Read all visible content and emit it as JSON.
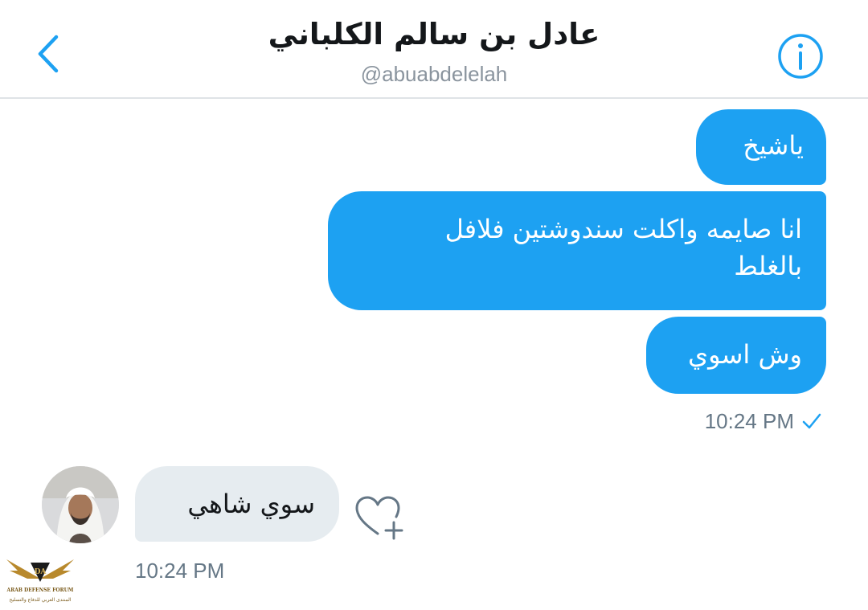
{
  "header": {
    "title": "عادل بن سالم الكلباني",
    "handle": "@abuabdelelah"
  },
  "icons": {
    "back": "chevron-left-icon",
    "info": "info-circle-icon",
    "check": "checkmark-icon",
    "heart_add": "heart-plus-icon"
  },
  "colors": {
    "accent": "#1da1f2",
    "sent_bubble": "#1da1f2",
    "received_bubble": "#e6ecf0",
    "muted_text": "#657786"
  },
  "conversation": {
    "sent_messages": [
      {
        "line1": "ياشيخ"
      },
      {
        "line1": "انا صايمه واكلت سندوشتين فلافل",
        "line2": "بالغلط"
      },
      {
        "line1": "وش اسوي"
      }
    ],
    "sent_time": "10:24 PM",
    "received_message": "سوي شاهي",
    "received_time": "10:24 PM"
  },
  "watermark": {
    "logo_text": "DA",
    "forum_name": "ARAB DEFENSE FORUM",
    "tagline": "المنتدى العربي للدفاع والتسليح"
  }
}
